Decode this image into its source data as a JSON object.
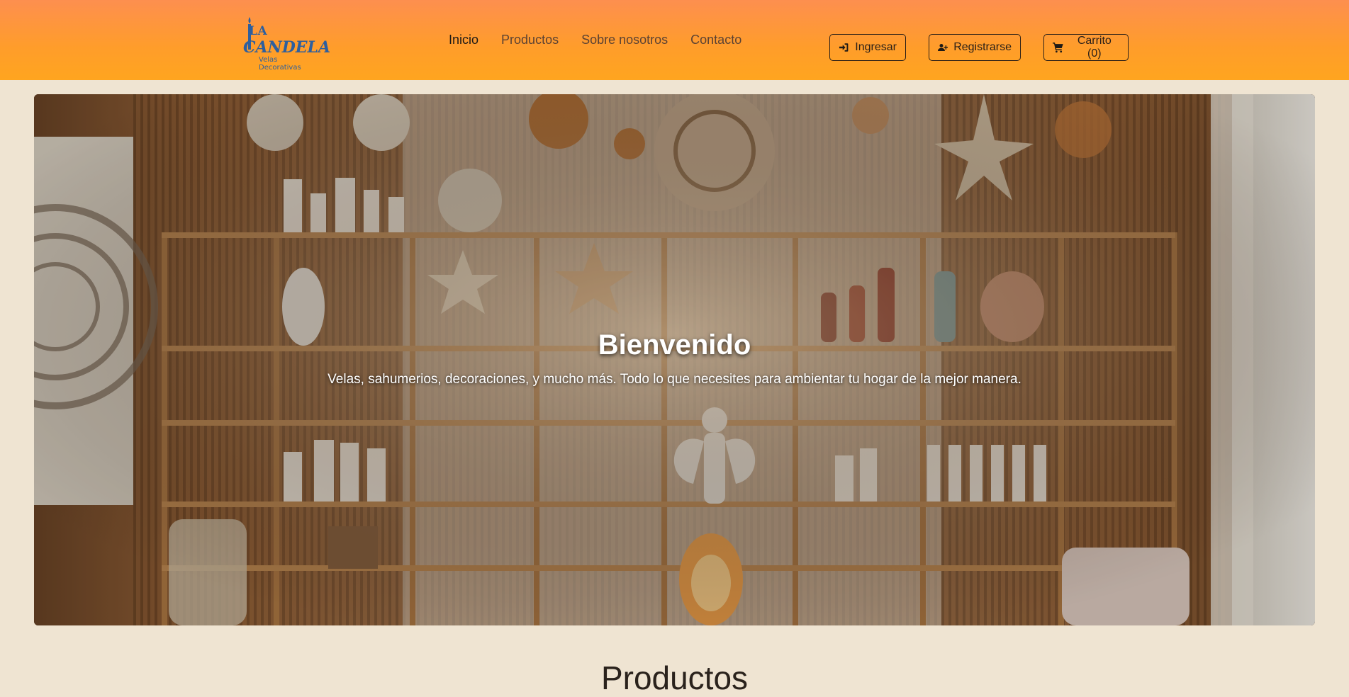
{
  "brand": {
    "line1": "LA",
    "line2": "CANDELA",
    "tagline": "Velas Decorativas",
    "color": "#2e5f9e"
  },
  "nav": {
    "links": [
      {
        "label": "Inicio",
        "active": true
      },
      {
        "label": "Productos",
        "active": false
      },
      {
        "label": "Sobre nosotros",
        "active": false
      },
      {
        "label": "Contacto",
        "active": false
      }
    ],
    "login_label": "Ingresar",
    "login_icon": "sign-in-icon",
    "register_label": "Registrarse",
    "register_icon": "user-plus-icon",
    "cart_label": "Carrito (0)",
    "cart_icon": "cart-icon"
  },
  "hero": {
    "title": "Bienvenido",
    "subtitle": "Velas, sahumerios, decoraciones, y mucho más. Todo lo que necesites para ambientar tu hogar de la mejor manera."
  },
  "section": {
    "heading": "Productos"
  },
  "colors": {
    "navbar_top": "#fd8f4f",
    "navbar_bottom": "#ffa51f",
    "page_background": "#efe4d2"
  }
}
